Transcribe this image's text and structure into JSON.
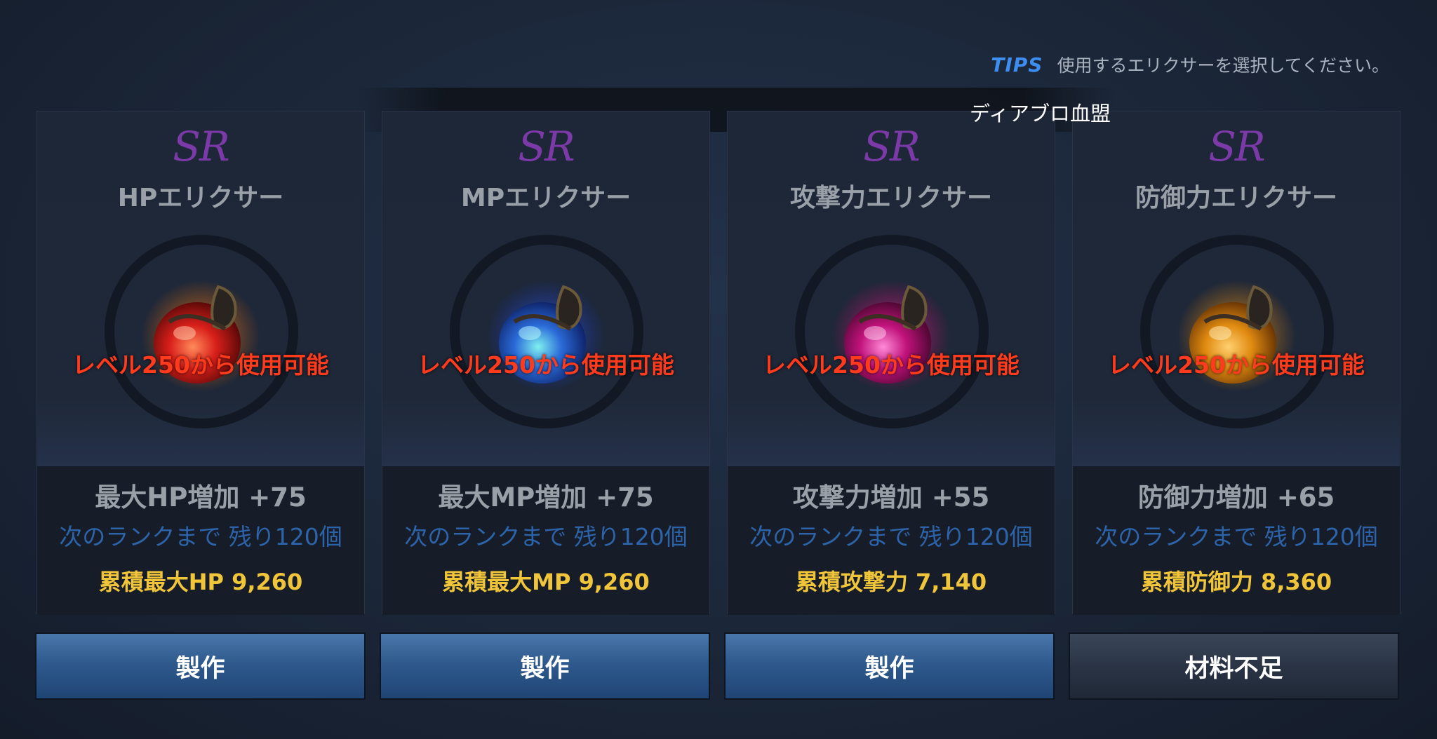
{
  "tips": {
    "tag": "TIPS",
    "text": "使用するエリクサーを選択してください。"
  },
  "guild_name": "ディアブロ血盟",
  "colors": {
    "rarity": "#7b3aa8",
    "lock_text": "#ff3b1e",
    "next_rank": "#2d63a8",
    "total": "#f0c53a",
    "button_primary": "#2f5a8e",
    "button_disabled": "#2a3445"
  },
  "elixirs": [
    {
      "rarity": "SR",
      "name": "HPエリクサー",
      "icon": "red-potion-icon",
      "lock_text": "レベル250から使用可能",
      "stat": "最大HP増加 +75",
      "next_rank": "次のランクまで 残り120個",
      "total": "累積最大HP 9,260",
      "button": "製作"
    },
    {
      "rarity": "SR",
      "name": "MPエリクサー",
      "icon": "blue-potion-icon",
      "lock_text": "レベル250から使用可能",
      "stat": "最大MP増加 +75",
      "next_rank": "次のランクまで 残り120個",
      "total": "累積最大MP 9,260",
      "button": "製作"
    },
    {
      "rarity": "SR",
      "name": "攻撃力エリクサー",
      "icon": "pink-potion-icon",
      "lock_text": "レベル250から使用可能",
      "stat": "攻撃力増加 +55",
      "next_rank": "次のランクまで 残り120個",
      "total": "累積攻撃力 7,140",
      "button": "製作"
    },
    {
      "rarity": "SR",
      "name": "防御力エリクサー",
      "icon": "orange-potion-icon",
      "lock_text": "レベル250から使用可能",
      "stat": "防御力増加 +65",
      "next_rank": "次のランクまで 残り120個",
      "total": "累積防御力 8,360",
      "button": "材料不足"
    }
  ]
}
